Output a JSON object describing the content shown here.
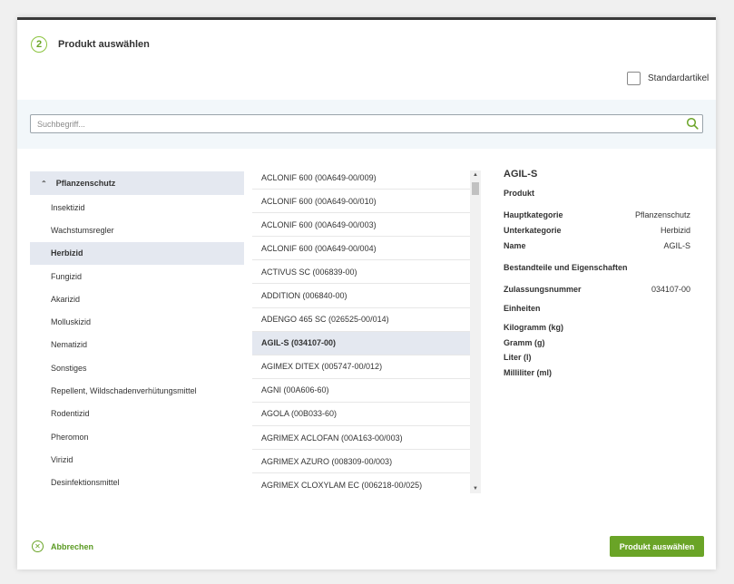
{
  "dialog": {
    "step_number": "2",
    "title": "Produkt auswählen",
    "standard_checkbox_label": "Standardartikel",
    "standard_checked": false
  },
  "search": {
    "placeholder": "Suchbegriff...",
    "value": ""
  },
  "categories": {
    "parent": "Pflanzenschutz",
    "items": [
      {
        "label": "Insektizid",
        "selected": false
      },
      {
        "label": "Wachstumsregler",
        "selected": false
      },
      {
        "label": "Herbizid",
        "selected": true
      },
      {
        "label": "Fungizid",
        "selected": false
      },
      {
        "label": "Akarizid",
        "selected": false
      },
      {
        "label": "Molluskizid",
        "selected": false
      },
      {
        "label": "Nematizid",
        "selected": false
      },
      {
        "label": "Sonstiges",
        "selected": false
      },
      {
        "label": "Repellent, Wildschadenverhütungsmittel",
        "selected": false
      },
      {
        "label": "Rodentizid",
        "selected": false
      },
      {
        "label": "Pheromon",
        "selected": false
      },
      {
        "label": "Virizid",
        "selected": false
      },
      {
        "label": "Desinfektionsmittel",
        "selected": false
      }
    ]
  },
  "products": [
    {
      "label": "ACLONIF 600 (00A649-00/009)",
      "selected": false
    },
    {
      "label": "ACLONIF 600 (00A649-00/010)",
      "selected": false
    },
    {
      "label": "ACLONIF 600 (00A649-00/003)",
      "selected": false
    },
    {
      "label": "ACLONIF 600 (00A649-00/004)",
      "selected": false
    },
    {
      "label": "ACTIVUS SC (006839-00)",
      "selected": false
    },
    {
      "label": "ADDITION (006840-00)",
      "selected": false
    },
    {
      "label": "ADENGO 465 SC (026525-00/014)",
      "selected": false
    },
    {
      "label": "AGIL-S (034107-00)",
      "selected": true
    },
    {
      "label": "AGIMEX DITEX (005747-00/012)",
      "selected": false
    },
    {
      "label": "AGNI (00A606-60)",
      "selected": false
    },
    {
      "label": "AGOLA (00B033-60)",
      "selected": false
    },
    {
      "label": "AGRIMEX ACLOFAN (00A163-00/003)",
      "selected": false
    },
    {
      "label": "AGRIMEX AZURO (008309-00/003)",
      "selected": false
    },
    {
      "label": "AGRIMEX CLOXYLAM EC (006218-00/025)",
      "selected": false
    }
  ],
  "details": {
    "title": "AGIL-S",
    "section_product": "Produkt",
    "hauptkategorie_label": "Hauptkategorie",
    "hauptkategorie_value": "Pflanzenschutz",
    "unterkategorie_label": "Unterkategorie",
    "unterkategorie_value": "Herbizid",
    "name_label": "Name",
    "name_value": "AGIL-S",
    "section_properties": "Bestandteile und Eigenschaften",
    "zulassung_label": "Zulassungsnummer",
    "zulassung_value": "034107-00",
    "section_units": "Einheiten",
    "units": [
      "Kilogramm (kg)",
      "Gramm (g)",
      "Liter (l)",
      "Milliliter (ml)"
    ]
  },
  "footer": {
    "cancel_label": "Abbrechen",
    "confirm_label": "Produkt auswählen"
  },
  "colors": {
    "accent": "#6aa427",
    "selection": "#e4e8f0",
    "search_band": "#f2f7fa"
  }
}
